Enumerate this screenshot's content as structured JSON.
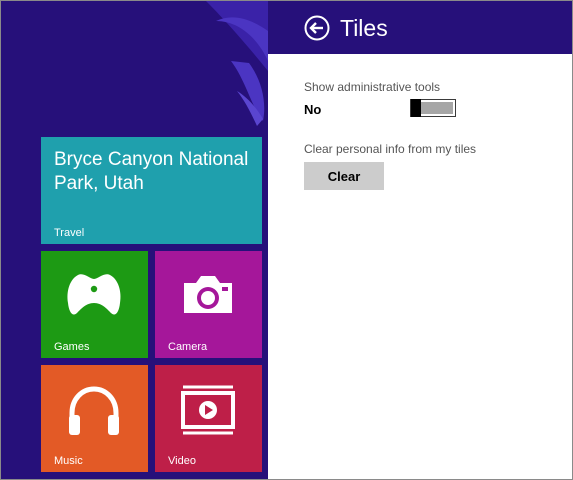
{
  "start": {
    "tiles": {
      "travel": {
        "headline": "Bryce Canyon National Park, Utah",
        "label": "Travel",
        "color": "#1fa0ad"
      },
      "games": {
        "label": "Games",
        "icon": "xbox-controller-icon",
        "color": "#1d9a14"
      },
      "camera": {
        "label": "Camera",
        "icon": "camera-icon",
        "color": "#a5179a"
      },
      "music": {
        "label": "Music",
        "icon": "headphones-icon",
        "color": "#e35a26"
      },
      "video": {
        "label": "Video",
        "icon": "video-player-icon",
        "color": "#be1f48"
      }
    },
    "background_color": "#26107a"
  },
  "flyout": {
    "title": "Tiles",
    "back_icon": "back-arrow-icon",
    "admin_tools": {
      "label": "Show administrative tools",
      "state": "No",
      "on": false
    },
    "clear_info": {
      "label": "Clear personal info from my tiles",
      "button_label": "Clear"
    }
  }
}
